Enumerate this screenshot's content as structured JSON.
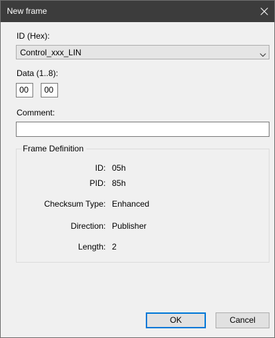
{
  "window": {
    "title": "New frame"
  },
  "id_field": {
    "label": "ID (Hex):",
    "selected": "Control_xxx_LIN"
  },
  "data_field": {
    "label": "Data (1..8):",
    "bytes": [
      "00",
      "00"
    ]
  },
  "comment_field": {
    "label": "Comment:",
    "value": ""
  },
  "frame_definition": {
    "title": "Frame Definition",
    "rows": [
      {
        "label": "ID:",
        "value": "05h"
      },
      {
        "label": "PID:",
        "value": "85h"
      },
      {
        "label": "Checksum Type:",
        "value": "Enhanced"
      },
      {
        "label": "Direction:",
        "value": "Publisher"
      },
      {
        "label": "Length:",
        "value": "2"
      }
    ]
  },
  "buttons": {
    "ok": "OK",
    "cancel": "Cancel"
  },
  "colors": {
    "titlebar": "#3c3c3c",
    "background": "#f0f0f0",
    "focus_border": "#0078d7"
  },
  "icons": {
    "close": "close-icon",
    "dropdown": "chevron-down-icon"
  }
}
